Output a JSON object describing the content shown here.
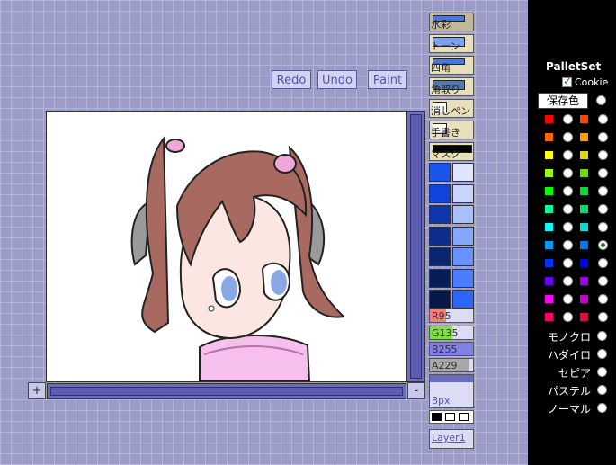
{
  "toolbar": {
    "redo": "Redo",
    "undo": "Undo",
    "paint": "Paint"
  },
  "tools": [
    {
      "label": "水彩"
    },
    {
      "label": "トーン"
    },
    {
      "label": "四角"
    },
    {
      "label": "角取り"
    },
    {
      "label": "消しペン"
    },
    {
      "label": "手書き"
    },
    {
      "label": "マスク"
    }
  ],
  "swatches": {
    "left": [
      "#1a55ee",
      "#1144dd",
      "#0d36b0",
      "#0b2d90",
      "#092670",
      "#071d55",
      "#06174a"
    ],
    "right": [
      "#dfe6ff",
      "#c8d6ff",
      "#a9c0ff",
      "#86a6ff",
      "#6892ff",
      "#4a7dff",
      "#2a66ff"
    ]
  },
  "rgb": {
    "r": "R95",
    "g": "G135",
    "b": "B255",
    "a": "A229"
  },
  "rgb_levels": {
    "r": 0.37,
    "g": 0.53,
    "b": 1.0,
    "a": 0.9
  },
  "pen_size": "8px",
  "layer": "Layer1",
  "canvas_controls": {
    "plus": "+",
    "minus": "-"
  },
  "palette": {
    "title": "PalletSet",
    "cookie_label": "Cookie",
    "cookie_checked": true,
    "save_button": "保存色",
    "rows": [
      [
        "#ff0000",
        "#ff4400"
      ],
      [
        "#ff6600",
        "#ff9900"
      ],
      [
        "#ffff00",
        "#dddd00"
      ],
      [
        "#99ff00",
        "#66dd00"
      ],
      [
        "#00ff00",
        "#00dd33"
      ],
      [
        "#00ff99",
        "#00dd77"
      ],
      [
        "#00ffff",
        "#00dddd"
      ],
      [
        "#0099ff",
        "#0077ee"
      ],
      [
        "#0033ff",
        "#0000ee"
      ],
      [
        "#6600ff",
        "#9900ee"
      ],
      [
        "#ff00ff",
        "#cc00cc"
      ],
      [
        "#ff0066",
        "#ee0044"
      ]
    ],
    "selected_row": 7,
    "presets": [
      "モノクロ",
      "ハダイロ",
      "セピア",
      "パステル",
      "ノーマル"
    ]
  }
}
